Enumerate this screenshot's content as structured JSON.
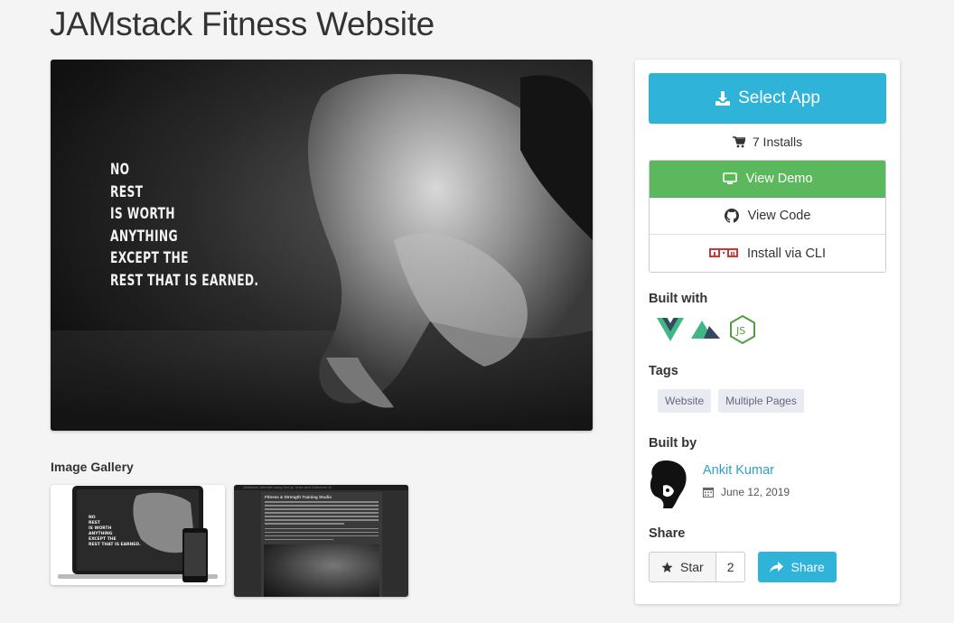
{
  "page": {
    "title": "JAMstack Fitness Website"
  },
  "hero": {
    "quote_lines": [
      "NO",
      "REST",
      "IS WORTH",
      "ANYTHING",
      "EXCEPT THE",
      "REST THAT IS EARNED."
    ]
  },
  "gallery": {
    "label": "Image Gallery",
    "thumb2_header": "JAMstack Website using Vue.js, Vuex and Gridsome v0",
    "thumb2_title": "Fitness & Strength Training Studio"
  },
  "sidebar": {
    "select_app": "Select App",
    "installs": "7 Installs",
    "actions": {
      "demo": "View Demo",
      "code": "View Code",
      "cli": "Install via CLI"
    },
    "built_with_label": "Built with",
    "built_with": [
      "vue-icon",
      "nuxt-icon",
      "nodejs-icon"
    ],
    "tags_label": "Tags",
    "tags": [
      "Website",
      "Multiple Pages"
    ],
    "built_by_label": "Built by",
    "author": {
      "name": "Ankit Kumar",
      "date": "June 12, 2019"
    },
    "share_label": "Share",
    "star_label": "Star",
    "star_count": "2",
    "share_button": "Share"
  },
  "colors": {
    "primary": "#2fb3d9",
    "demo_green": "#5cb85c",
    "npm_red": "#cb3837",
    "vue_green": "#41b883",
    "vue_dark": "#35495e"
  }
}
